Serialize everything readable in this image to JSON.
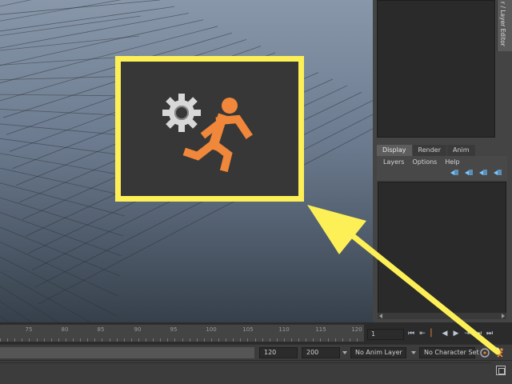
{
  "right_panel": {
    "side_tab_label": "r / Layer Editor",
    "tabs": [
      {
        "label": "Display",
        "active": true
      },
      {
        "label": "Render",
        "active": false
      },
      {
        "label": "Anim",
        "active": false
      }
    ],
    "menus": [
      "Layers",
      "Options",
      "Help"
    ]
  },
  "time_slider": {
    "tick_labels": [
      "75",
      "80",
      "85",
      "90",
      "95",
      "100",
      "105",
      "110",
      "115",
      "120"
    ],
    "current_frame": "1"
  },
  "range_slider": {
    "end_time": "120",
    "playback_end": "200",
    "anim_layer": "No Anim Layer",
    "character_set": "No Character Set"
  },
  "icons": {
    "callout": "auto-keyframe-toggle-icon",
    "anim_prefs": "animation-preferences-icon"
  },
  "colors": {
    "callout_border": "#fdf057",
    "running_man": "#f0873a",
    "gear": "#d8d8d8",
    "arrow": "#fdf057"
  }
}
